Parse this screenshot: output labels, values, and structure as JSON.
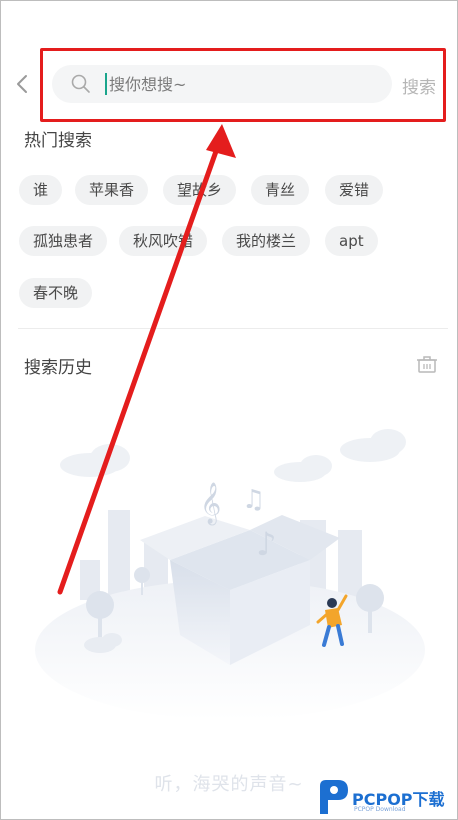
{
  "search": {
    "placeholder": "搜你想搜~",
    "action_label": "搜索"
  },
  "hot": {
    "title": "热门搜索",
    "tags": [
      "谁",
      "苹果香",
      "望故乡",
      "青丝",
      "爱错",
      "孤独患者",
      "秋风吹错",
      "我的楼兰",
      "apt",
      "春不晚"
    ]
  },
  "history": {
    "title": "搜索历史",
    "empty_slogan": "听，海哭的声音~"
  },
  "watermark": {
    "brand": "PCPOP下载",
    "sub": "PCPOP Download"
  },
  "colors": {
    "accent": "#1aa58c",
    "annotation_red": "#e41d1d"
  },
  "icons": {
    "back": "chevron-left-icon",
    "search": "search-icon",
    "clear_history": "trash-icon"
  }
}
